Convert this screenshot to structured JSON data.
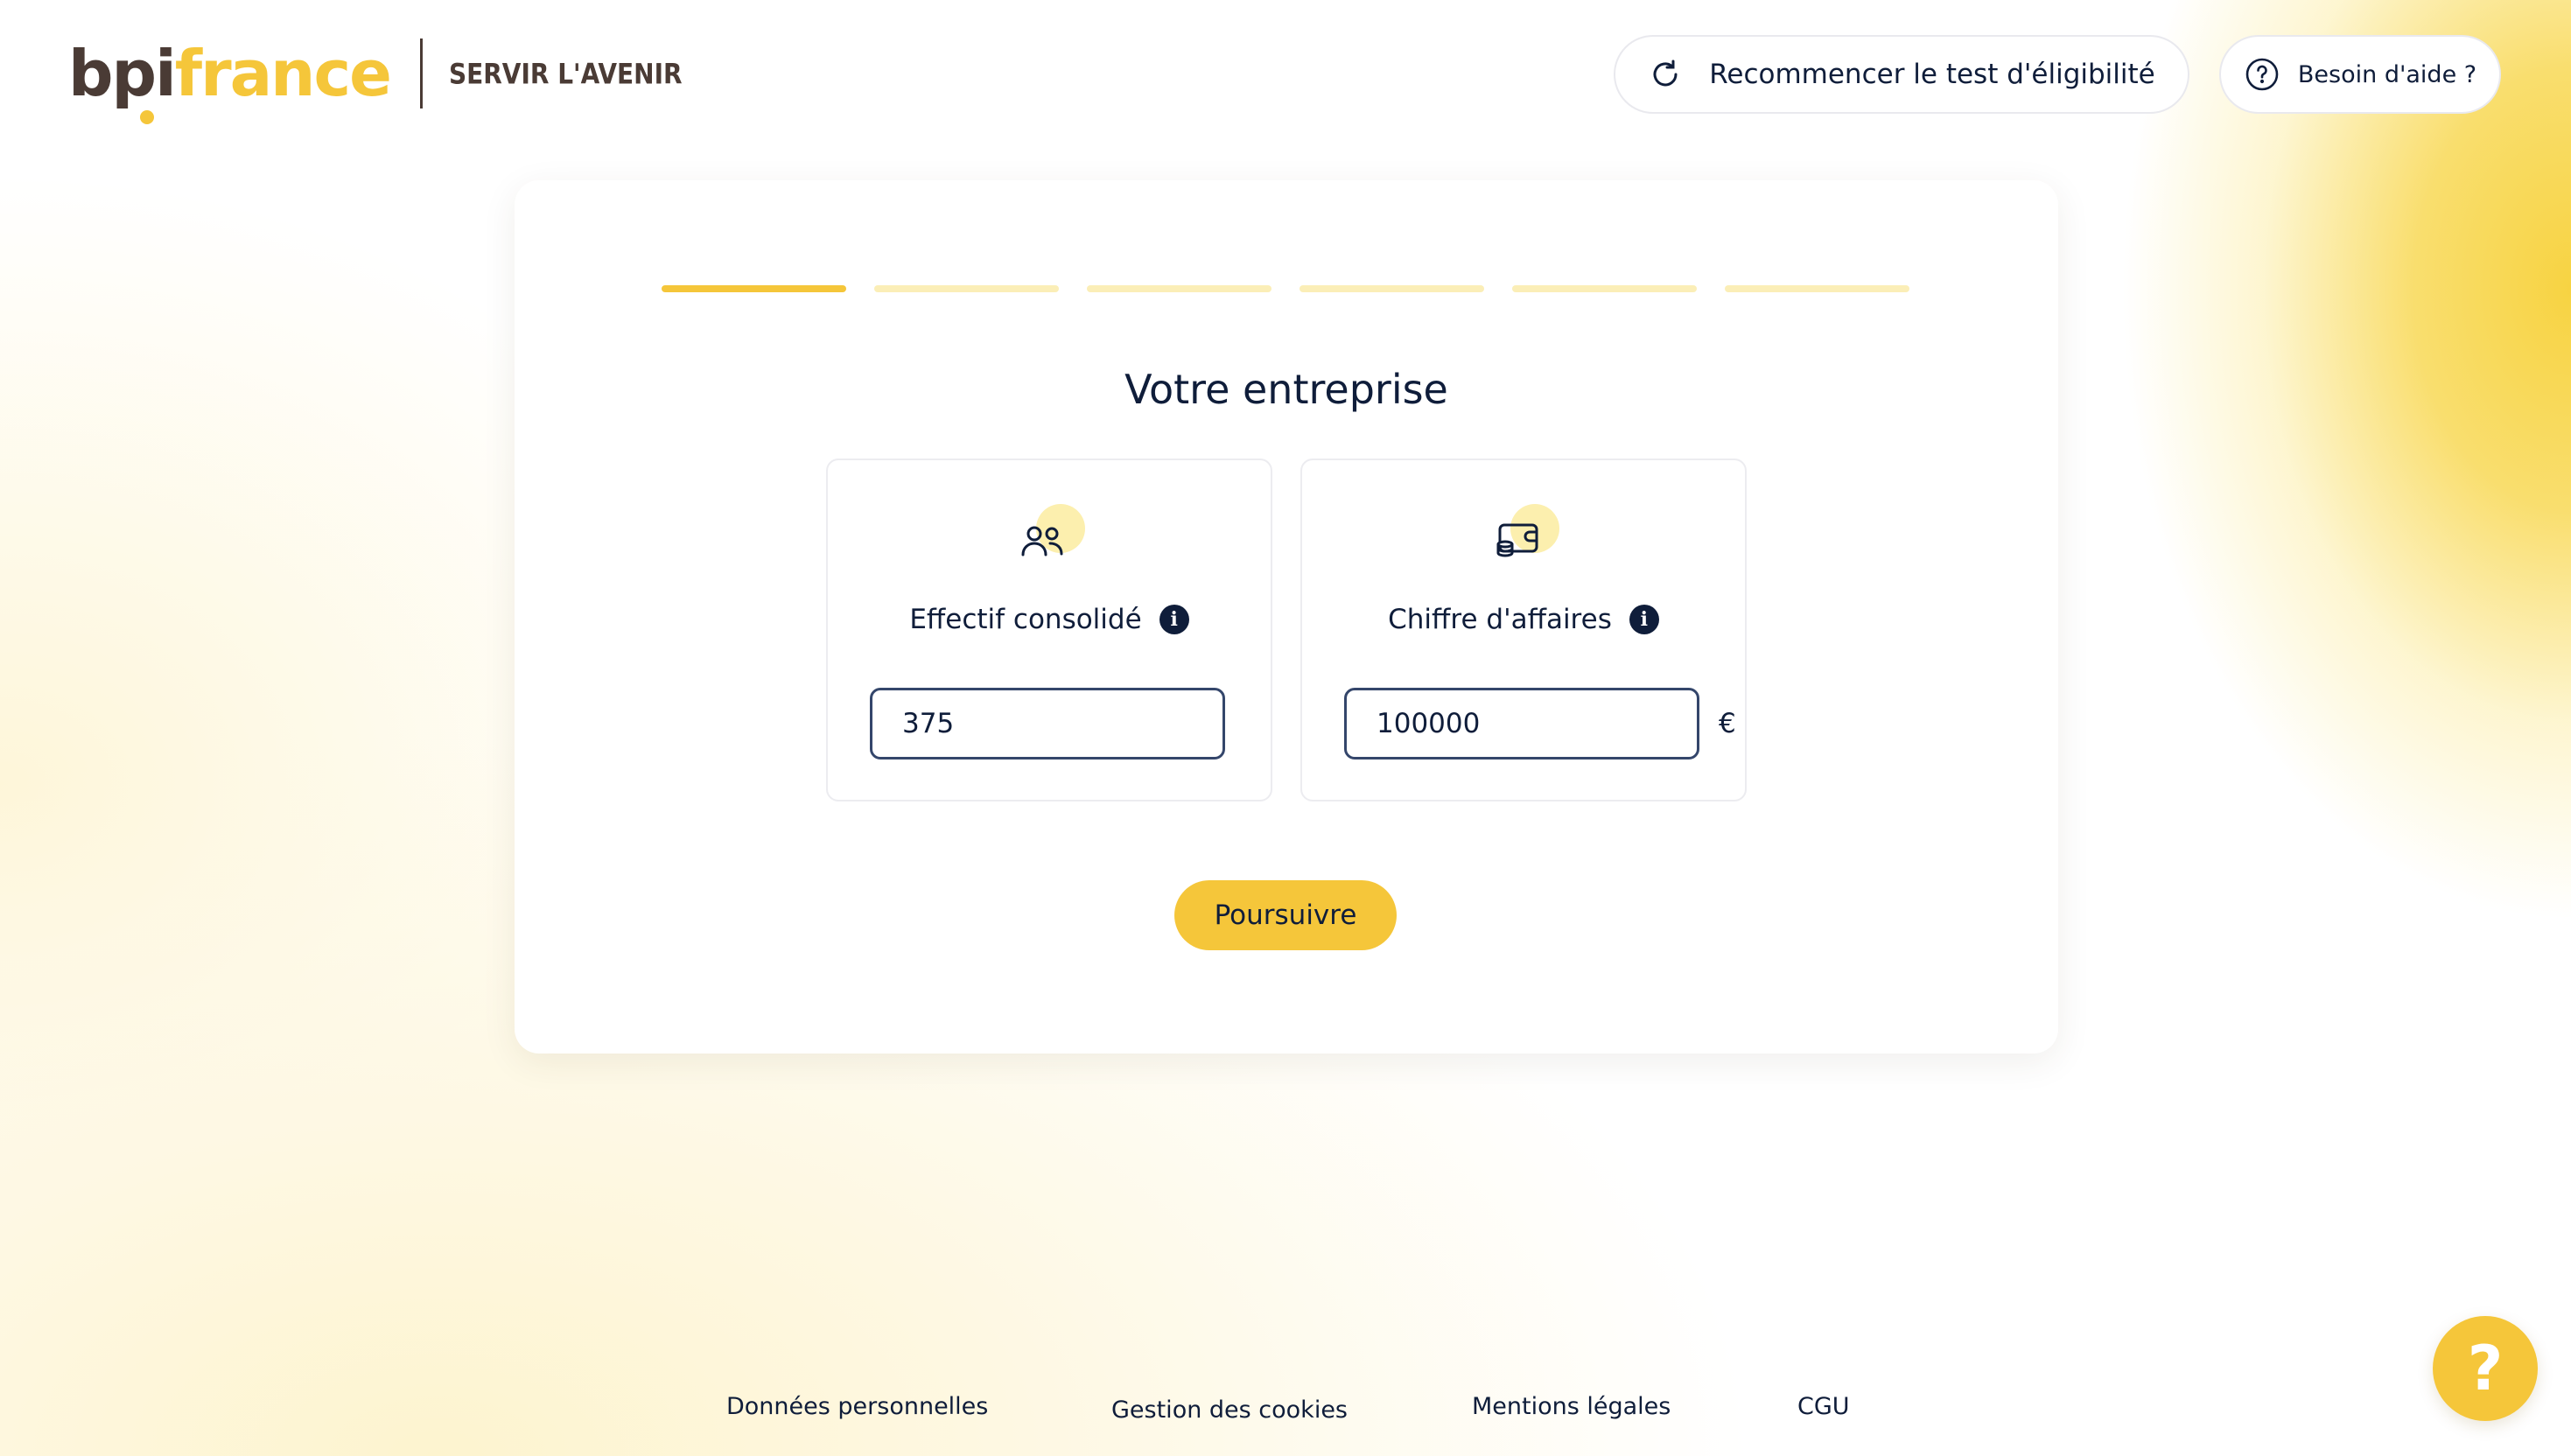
{
  "header": {
    "logo": {
      "part1": "bpi",
      "part2": "france",
      "slogan": "SERVIR L'AVENIR"
    },
    "restart_label": "Recommencer le test d'éligibilité",
    "help_label": "Besoin d'aide ?"
  },
  "progress": {
    "total_steps": 6,
    "current_step": 1
  },
  "form": {
    "title": "Votre entreprise",
    "fields": [
      {
        "label": "Effectif consolidé",
        "value": "375",
        "icon": "people-icon"
      },
      {
        "label": "Chiffre d'affaires",
        "value": "100000",
        "suffix": "€",
        "icon": "coins-wallet-icon"
      }
    ],
    "submit_label": "Poursuivre"
  },
  "footer": {
    "links": [
      "Données personnelles",
      "Gestion des cookies",
      "Mentions légales",
      "CGU"
    ]
  },
  "fab": {
    "label": "?"
  },
  "colors": {
    "accent": "#f5c63a",
    "text": "#0f1d3a",
    "brand_brown": "#4a3b35",
    "step_inactive": "#fbeeb7"
  }
}
